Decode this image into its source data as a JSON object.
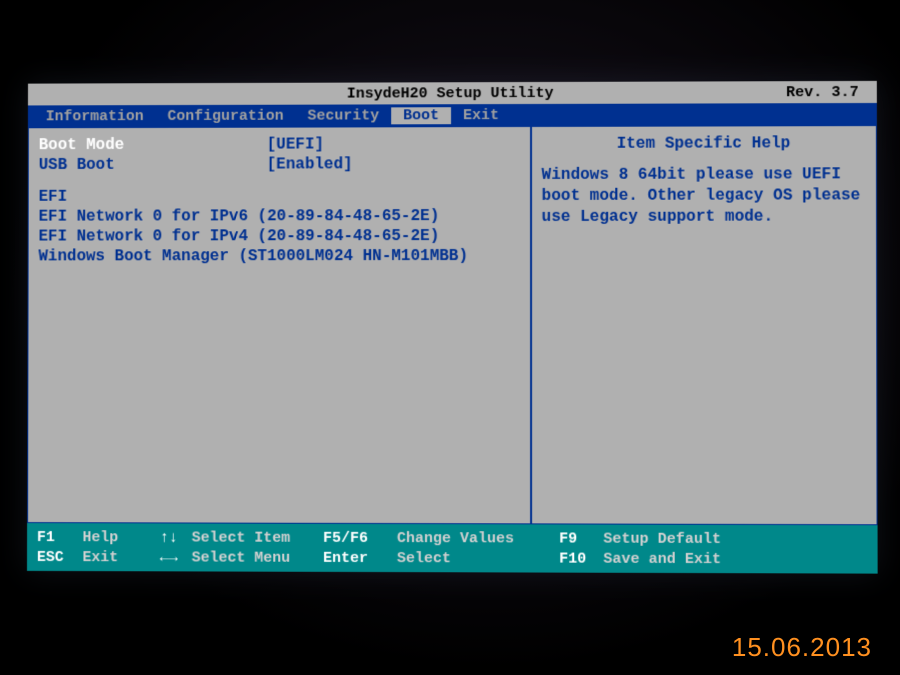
{
  "title": "InsydeH20 Setup Utility",
  "revision": "Rev. 3.7",
  "menu": {
    "items": [
      "Information",
      "Configuration",
      "Security",
      "Boot",
      "Exit"
    ],
    "active": 3
  },
  "settings": {
    "boot_mode": {
      "label": "Boot Mode",
      "value": "[UEFI]"
    },
    "usb_boot": {
      "label": "USB Boot",
      "value": "[Enabled]"
    }
  },
  "efi_section": "EFI",
  "boot_entries": [
    "EFI Network 0 for IPv6 (20-89-84-48-65-2E)",
    "EFI Network 0 for IPv4 (20-89-84-48-65-2E)",
    "Windows Boot Manager (ST1000LM024 HN-M101MBB)"
  ],
  "help": {
    "title": "Item Specific Help",
    "text": "Windows 8 64bit please use UEFI boot mode. Other legacy OS please use Legacy support mode."
  },
  "footer": {
    "r1": {
      "k1": "F1",
      "d1": "Help",
      "a2": "↑↓",
      "d2": "Select Item",
      "k3": "F5/F6",
      "d3": "Change Values",
      "k4": "F9",
      "d4": "Setup Default"
    },
    "r2": {
      "k1": "ESC",
      "d1": "Exit",
      "a2": "←→",
      "d2": "Select Menu",
      "k3": "Enter",
      "d3": "Select",
      "k4": "F10",
      "d4": "Save and Exit"
    }
  },
  "photo_date": "15.06.2013"
}
